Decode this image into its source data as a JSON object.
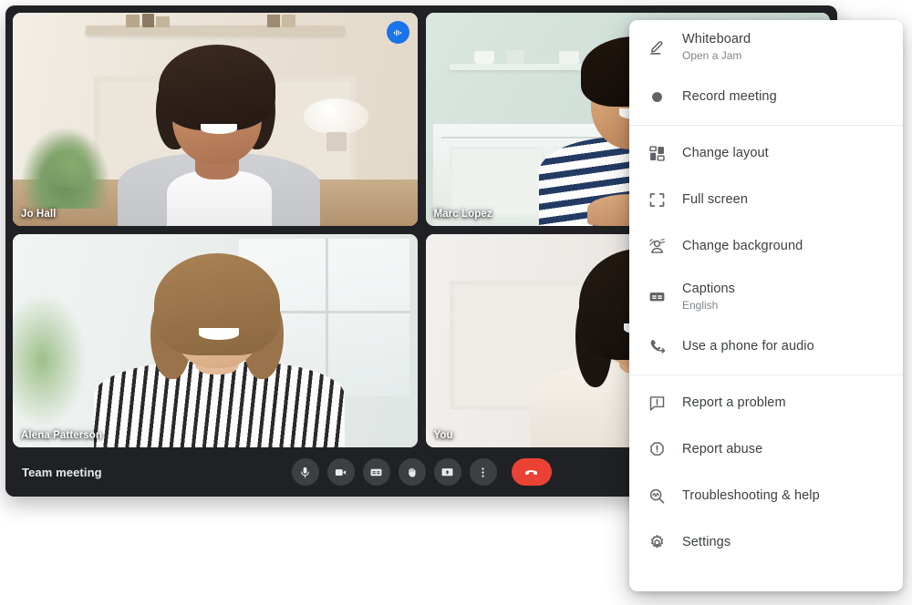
{
  "app": {
    "meeting_title": "Team meeting"
  },
  "participants": [
    {
      "name": "Jo Hall",
      "badge": "speaking-icon",
      "active_speaker": true,
      "position": "top-left"
    },
    {
      "name": "Marc Lopez",
      "badge": "mic-muted-icon",
      "active_speaker": false,
      "position": "top-right"
    },
    {
      "name": "Alena Patterson",
      "badge": "",
      "active_speaker": false,
      "position": "bottom-left"
    },
    {
      "name": "You",
      "badge": "",
      "active_speaker": false,
      "position": "bottom-right"
    }
  ],
  "controls": [
    {
      "name": "microphone-button",
      "icon": "microphone-icon"
    },
    {
      "name": "camera-button",
      "icon": "video-camera-icon"
    },
    {
      "name": "captions-button",
      "icon": "closed-captions-icon"
    },
    {
      "name": "raise-hand-button",
      "icon": "raised-hand-icon"
    },
    {
      "name": "present-screen-button",
      "icon": "present-screen-icon"
    },
    {
      "name": "more-options-button",
      "icon": "more-vertical-icon"
    },
    {
      "name": "end-call-button",
      "icon": "end-call-icon"
    }
  ],
  "options_menu": {
    "groups": [
      {
        "items": [
          {
            "label": "Whiteboard",
            "sub": "Open a Jam",
            "icon": "pen-icon"
          },
          {
            "label": "Record meeting",
            "sub": "",
            "icon": "record-dot-icon"
          }
        ]
      },
      {
        "items": [
          {
            "label": "Change layout",
            "sub": "",
            "icon": "layout-grid-icon"
          },
          {
            "label": "Full screen",
            "sub": "",
            "icon": "fullscreen-icon"
          },
          {
            "label": "Change background",
            "sub": "",
            "icon": "change-background-icon"
          },
          {
            "label": "Captions",
            "sub": "English",
            "icon": "closed-captions-icon"
          },
          {
            "label": "Use a phone for audio",
            "sub": "",
            "icon": "phone-forward-icon"
          }
        ]
      },
      {
        "items": [
          {
            "label": "Report a problem",
            "sub": "",
            "icon": "report-problem-icon"
          },
          {
            "label": "Report abuse",
            "sub": "",
            "icon": "report-abuse-icon"
          },
          {
            "label": "Troubleshooting & help",
            "sub": "",
            "icon": "troubleshooting-icon"
          },
          {
            "label": "Settings",
            "sub": "",
            "icon": "gear-icon"
          }
        ]
      }
    ]
  },
  "colors": {
    "window_background": "#202124",
    "tile_background": "#3c4043",
    "active_speaker_border": "#4285f4",
    "speaking_badge": "#1a73e8",
    "end_call": "#ea4335",
    "menu_background": "#ffffff",
    "menu_label": "#3c4043",
    "menu_sublabel": "#80868b",
    "menu_icon": "#5f6368"
  }
}
